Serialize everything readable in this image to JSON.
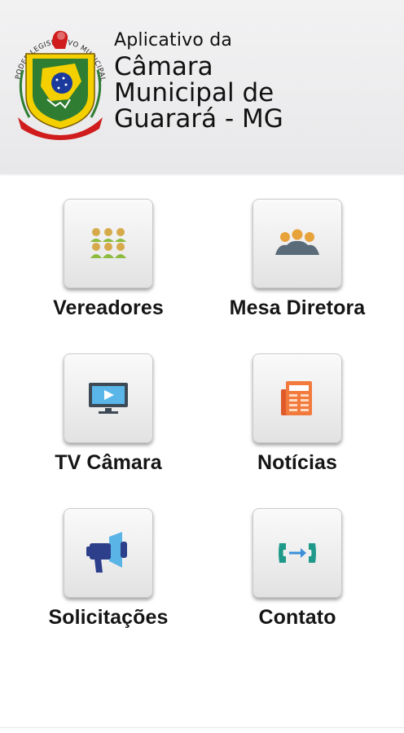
{
  "header": {
    "logo_ring_text": "PODER LEGISLATIVO MUNICIPAL",
    "subtitle": "Aplicativo da",
    "title_lines": [
      "Câmara",
      "Municipal de",
      "Guarará - MG"
    ]
  },
  "menu": [
    {
      "label": "Vereadores",
      "icon": "people-group-icon"
    },
    {
      "label": "Mesa Diretora",
      "icon": "board-members-icon"
    },
    {
      "label": "TV Câmara",
      "icon": "tv-monitor-icon"
    },
    {
      "label": "Notícias",
      "icon": "newspaper-icon"
    },
    {
      "label": "Solicitações",
      "icon": "megaphone-icon"
    },
    {
      "label": "Contato",
      "icon": "phone-transfer-icon"
    }
  ],
  "colors": {
    "header_bg": "#ececee",
    "logo_green": "#2e7d32",
    "logo_yellow": "#f4d000",
    "logo_red": "#d01c1c",
    "logo_blue": "#1a3a9c"
  }
}
